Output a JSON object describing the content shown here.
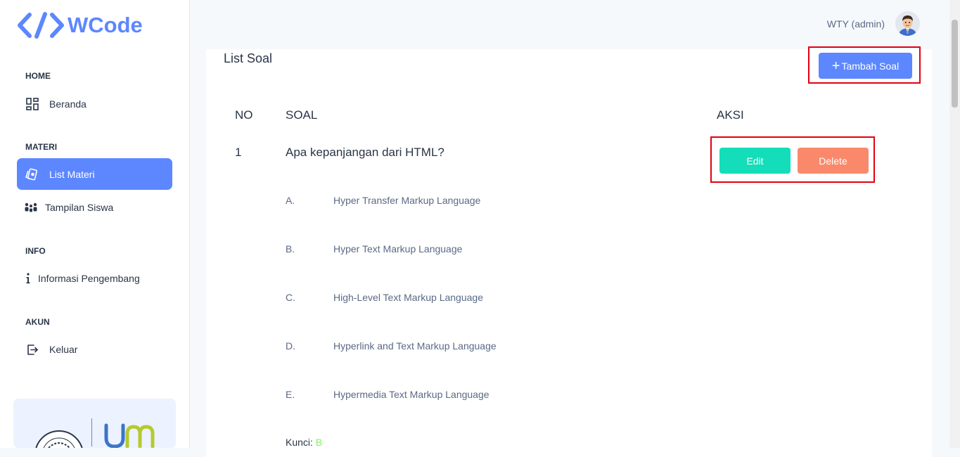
{
  "brand": {
    "name": "WCode",
    "color": "#5d87ff"
  },
  "sidebar": {
    "sections": [
      {
        "caption": "HOME",
        "items": [
          {
            "label": "Beranda",
            "icon": "dashboard-icon"
          }
        ]
      },
      {
        "caption": "MATERI",
        "items": [
          {
            "label": "List Materi",
            "icon": "cards-icon",
            "active": true
          },
          {
            "label": "Tampilan Siswa",
            "icon": "users-icon"
          }
        ]
      },
      {
        "caption": "INFO",
        "items": [
          {
            "label": "Informasi Pengembang",
            "icon": "info-icon"
          }
        ]
      },
      {
        "caption": "AKUN",
        "items": [
          {
            "label": "Keluar",
            "icon": "logout-icon"
          }
        ]
      }
    ]
  },
  "header": {
    "user_label": "WTY (admin)"
  },
  "page": {
    "title": "List Soal",
    "add_button": "Tambah Soal",
    "table": {
      "headers": {
        "no": "NO",
        "soal": "SOAL",
        "aksi": "AKSI"
      },
      "row": {
        "no": "1",
        "question": "Apa kepanjangan dari HTML?",
        "edit_label": "Edit",
        "delete_label": "Delete",
        "options": [
          {
            "letter": "A.",
            "text": "Hyper Transfer Markup Language"
          },
          {
            "letter": "B.",
            "text": "Hyper Text Markup Language"
          },
          {
            "letter": "C.",
            "text": "High-Level Text Markup Language"
          },
          {
            "letter": "D.",
            "text": "Hyperlink and Text Markup Language"
          },
          {
            "letter": "E.",
            "text": "Hypermedia Text Markup Language"
          }
        ],
        "key_label": "Kunci:",
        "key_value": "B"
      }
    }
  },
  "colors": {
    "primary": "#5d87ff",
    "success": "#13deb9",
    "danger": "#fa896b",
    "highlight": "#e3000f",
    "key": "#7cf65b"
  }
}
